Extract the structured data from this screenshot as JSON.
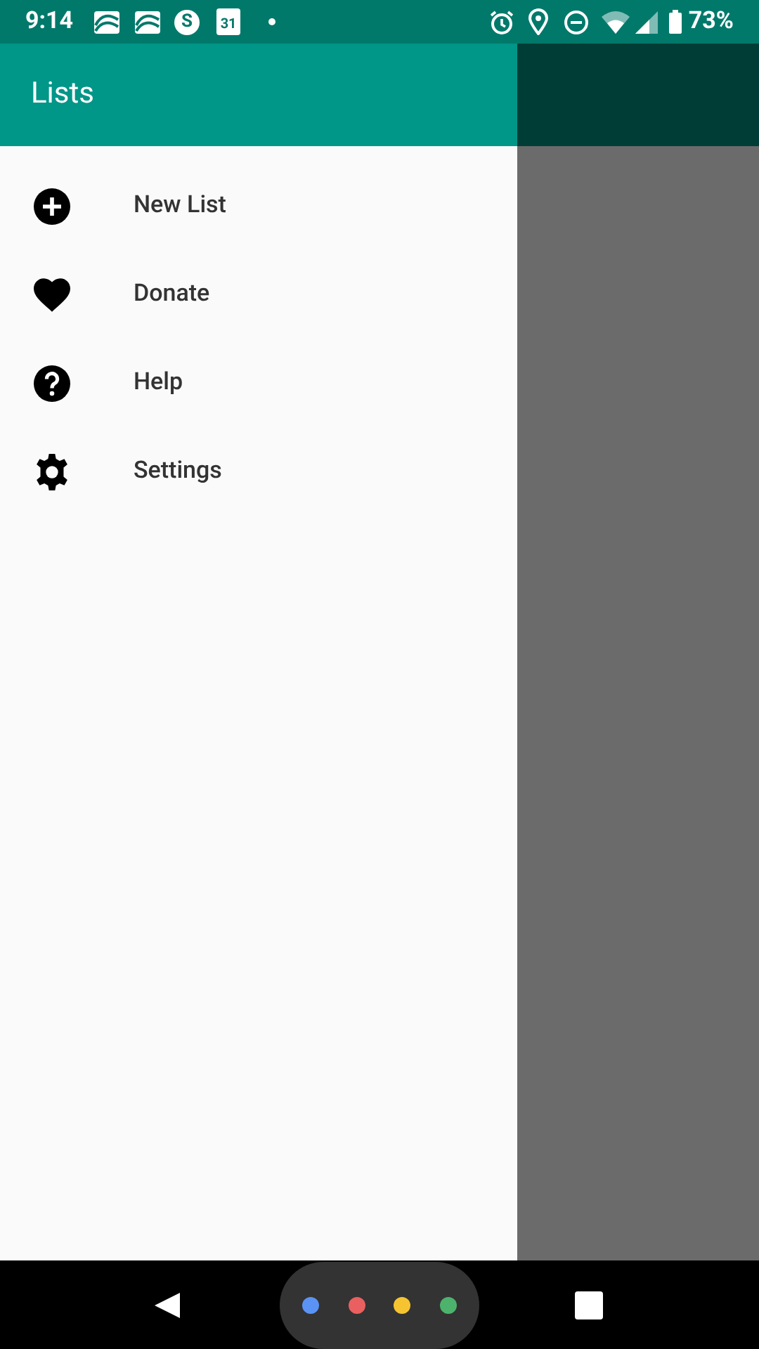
{
  "status_bar": {
    "time": "9:14",
    "app_icon_letter": "S",
    "calendar_day": "31",
    "battery": "73%"
  },
  "drawer": {
    "title": "Lists",
    "items": [
      {
        "kind": "add",
        "label": "New List"
      },
      {
        "kind": "heart",
        "label": "Donate"
      },
      {
        "kind": "help",
        "label": "Help"
      },
      {
        "kind": "settings",
        "label": "Settings"
      }
    ]
  }
}
